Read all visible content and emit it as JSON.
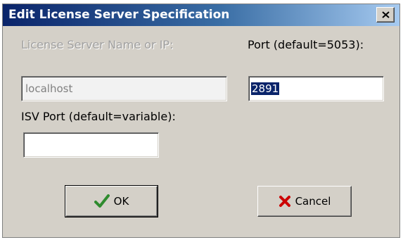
{
  "window": {
    "title": "Edit License Server Specification",
    "close_glyph": "X"
  },
  "fields": {
    "server_name": {
      "label": "License Server Name or IP:",
      "value": "localhost",
      "enabled": false
    },
    "port": {
      "label": "Port (default=5053):",
      "value": "2891",
      "selected": true
    },
    "isv_port": {
      "label": "ISV Port (default=variable):",
      "value": ""
    }
  },
  "buttons": {
    "ok": {
      "label": "OK",
      "icon": "check-icon",
      "icon_color": "#2e8b2e"
    },
    "cancel": {
      "label": "Cancel",
      "icon": "x-mark-icon",
      "icon_color": "#cc0000"
    }
  },
  "colors": {
    "titlebar_start": "#0a246a",
    "titlebar_end": "#a6caf0",
    "face": "#d4d0c8",
    "selection": "#0a246a"
  }
}
